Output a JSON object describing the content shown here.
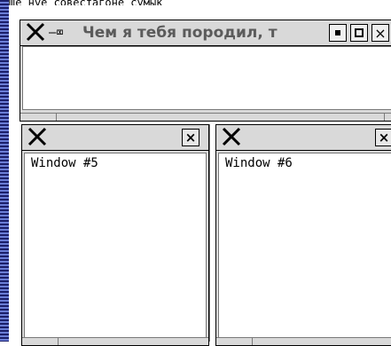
{
  "top_partial_text": "Ще нуе совестагоне сумык",
  "windows": [
    {
      "id": "main",
      "title": "Чем я тебя породил, т",
      "client_text": ""
    },
    {
      "id": "w5",
      "title": "",
      "client_text": "Window #5"
    },
    {
      "id": "w6",
      "title": "",
      "client_text": "Window #6"
    }
  ],
  "icons": {
    "app_logo": "x-logo-icon",
    "pin": "pin-icon",
    "minimize": "minimize-icon",
    "maximize": "maximize-icon",
    "close": "close-icon"
  },
  "colors": {
    "frame": "#d9d9d9",
    "title_text": "#5b5b5b",
    "left_strip_dark": "#1b1f6a",
    "left_strip_light": "#6a7dd6"
  }
}
